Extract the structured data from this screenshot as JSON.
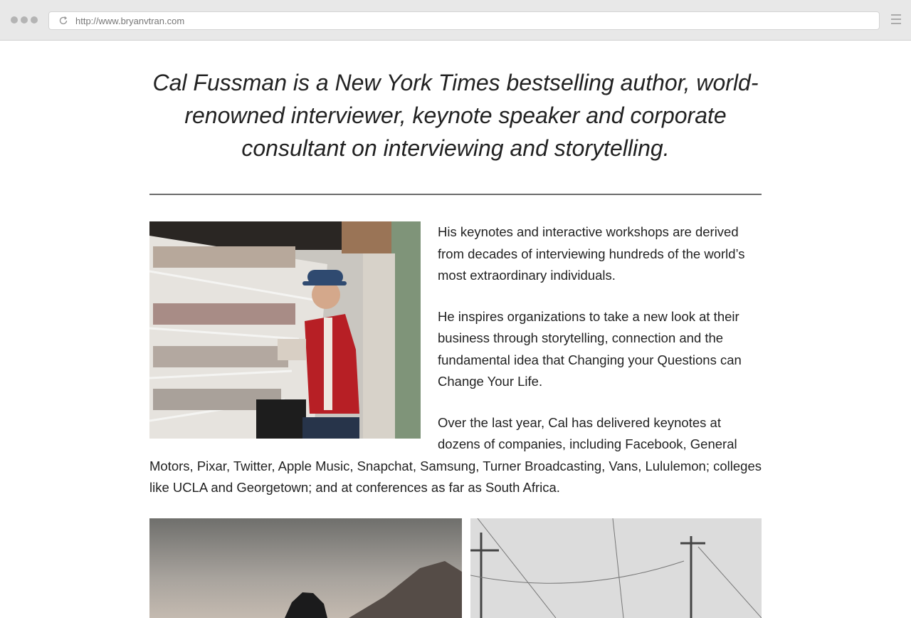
{
  "browser": {
    "url": "http://www.bryanvtran.com",
    "icons": {
      "reload": "reload-icon",
      "menu": "hamburger-menu-icon"
    }
  },
  "intro": {
    "quote": "Cal Fussman is a New York Times bestselling author, world-renowned interviewer, keynote speaker and corporate consultant on interviewing and storytelling."
  },
  "bio": {
    "paragraphs": [
      "His keynotes and interactive workshops are derived from decades of interviewing hundreds of the world’s most extraordinary individuals.",
      "He inspires organizations to take a new look at their business through storytelling, connection and the fundamental idea that Changing your Questions can Change Your Life.",
      "Over the last year, Cal has delivered keynotes at dozens of companies, including Facebook, General Motors, Pixar, Twitter, Apple Music, Snapchat, Samsung, Turner Broadcasting, Vans, Lululemon; colleges like UCLA and Georgetown; and at conferences as far as South Africa."
    ]
  },
  "colors": {
    "text": "#222222",
    "rule": "#6b6b6b",
    "chrome": "#e8e8e8"
  }
}
